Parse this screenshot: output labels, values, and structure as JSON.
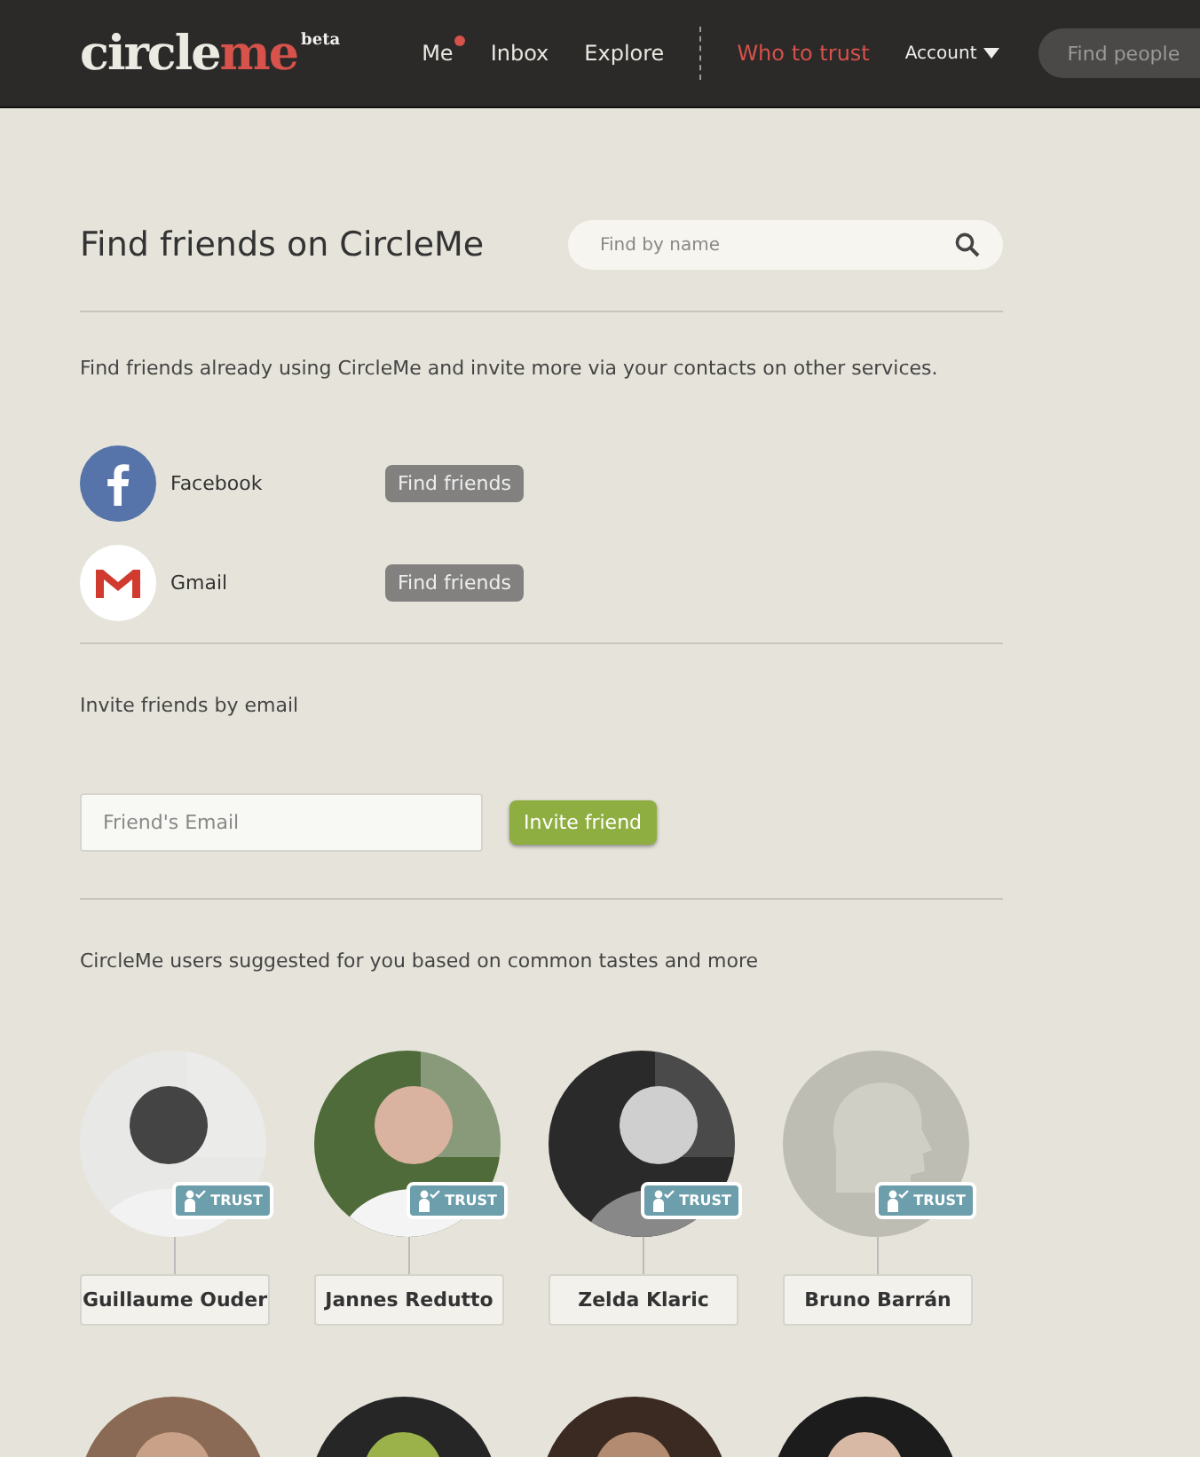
{
  "header": {
    "logo": {
      "first": "circle",
      "second": "me",
      "badge": "beta"
    },
    "nav": [
      {
        "label": "Me",
        "selected": false,
        "notification": true
      },
      {
        "label": "Inbox",
        "selected": false,
        "notification": false
      },
      {
        "label": "Explore",
        "selected": false,
        "notification": false
      },
      {
        "label": "Who to trust",
        "selected": true,
        "notification": false
      }
    ],
    "account": "Account",
    "search": {
      "placeholder": "Find people"
    }
  },
  "title": "Find friends on CircleMe",
  "name_search": {
    "placeholder": "Find by name"
  },
  "intro": "Find friends already using CircleMe and invite more via your contacts on other services.",
  "services": [
    {
      "kind": "facebook",
      "name": "Facebook",
      "button": "Find friends"
    },
    {
      "kind": "gmail",
      "name": "Gmail",
      "button": "Find friends"
    }
  ],
  "invite": {
    "label": "Invite friends by email",
    "placeholder": "Friend's Email",
    "button": "Invite friend"
  },
  "suggestions_label": "CircleMe users suggested for you based on common tastes and more",
  "suggestions": [
    {
      "kind": "picture",
      "name": "Guillaume Ouder",
      "trust": "TRUST"
    },
    {
      "kind": "picture",
      "name": "Jannes Redutto",
      "trust": "TRUST"
    },
    {
      "kind": "picture",
      "name": "Zelda Klaric",
      "trust": "TRUST"
    },
    {
      "kind": "default",
      "name": "Bruno Barrán",
      "trust": "TRUST"
    }
  ]
}
